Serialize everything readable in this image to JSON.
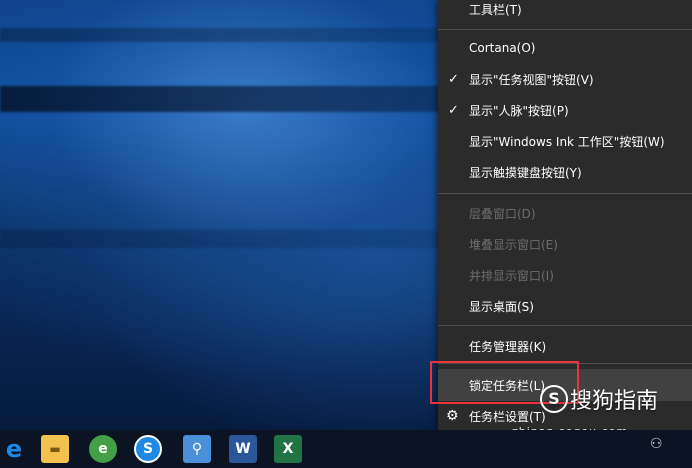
{
  "menu": {
    "items": [
      {
        "label": "工具栏(T)",
        "check": false,
        "disabled": false
      },
      {
        "label": "Cortana(O)",
        "check": false,
        "disabled": false
      },
      {
        "label": "显示\"任务视图\"按钮(V)",
        "check": true,
        "disabled": false
      },
      {
        "label": "显示\"人脉\"按钮(P)",
        "check": true,
        "disabled": false
      },
      {
        "label": "显示\"Windows Ink 工作区\"按钮(W)",
        "check": false,
        "disabled": false
      },
      {
        "label": "显示触摸键盘按钮(Y)",
        "check": false,
        "disabled": false
      },
      {
        "label": "层叠窗口(D)",
        "check": false,
        "disabled": true
      },
      {
        "label": "堆叠显示窗口(E)",
        "check": false,
        "disabled": true
      },
      {
        "label": "并排显示窗口(I)",
        "check": false,
        "disabled": true
      },
      {
        "label": "显示桌面(S)",
        "check": false,
        "disabled": false
      },
      {
        "label": "任务管理器(K)",
        "check": false,
        "disabled": false
      },
      {
        "label": "锁定任务栏(L)",
        "check": false,
        "disabled": false
      },
      {
        "label": "任务栏设置(T)",
        "check": false,
        "disabled": false
      }
    ],
    "check_glyph": "✓",
    "gear_icon": "gear-icon"
  },
  "watermark": {
    "brand": "搜狗指南",
    "logo_char": "S",
    "url": "zhinan.sogou.com"
  },
  "taskbar": {
    "icons": [
      {
        "name": "edge-icon",
        "char": "e",
        "color": "#1e88e5"
      },
      {
        "name": "file-explorer-icon",
        "char": "▬",
        "color": "#f2c14e"
      },
      {
        "name": "browser-360-icon",
        "char": "e",
        "color": "#43a047"
      },
      {
        "name": "sogou-browser-icon",
        "char": "S",
        "color": "#1e88e5"
      },
      {
        "name": "app-icon",
        "char": "⚲",
        "color": "#4a90d9"
      },
      {
        "name": "word-icon",
        "char": "W",
        "color": "#2b579a"
      },
      {
        "name": "excel-icon",
        "char": "X",
        "color": "#217346"
      }
    ],
    "tray_people_glyph": "⚇"
  },
  "colors": {
    "menu_bg": "#2b2b2b",
    "menu_hover": "#414141",
    "highlight_border": "#e8323c"
  }
}
